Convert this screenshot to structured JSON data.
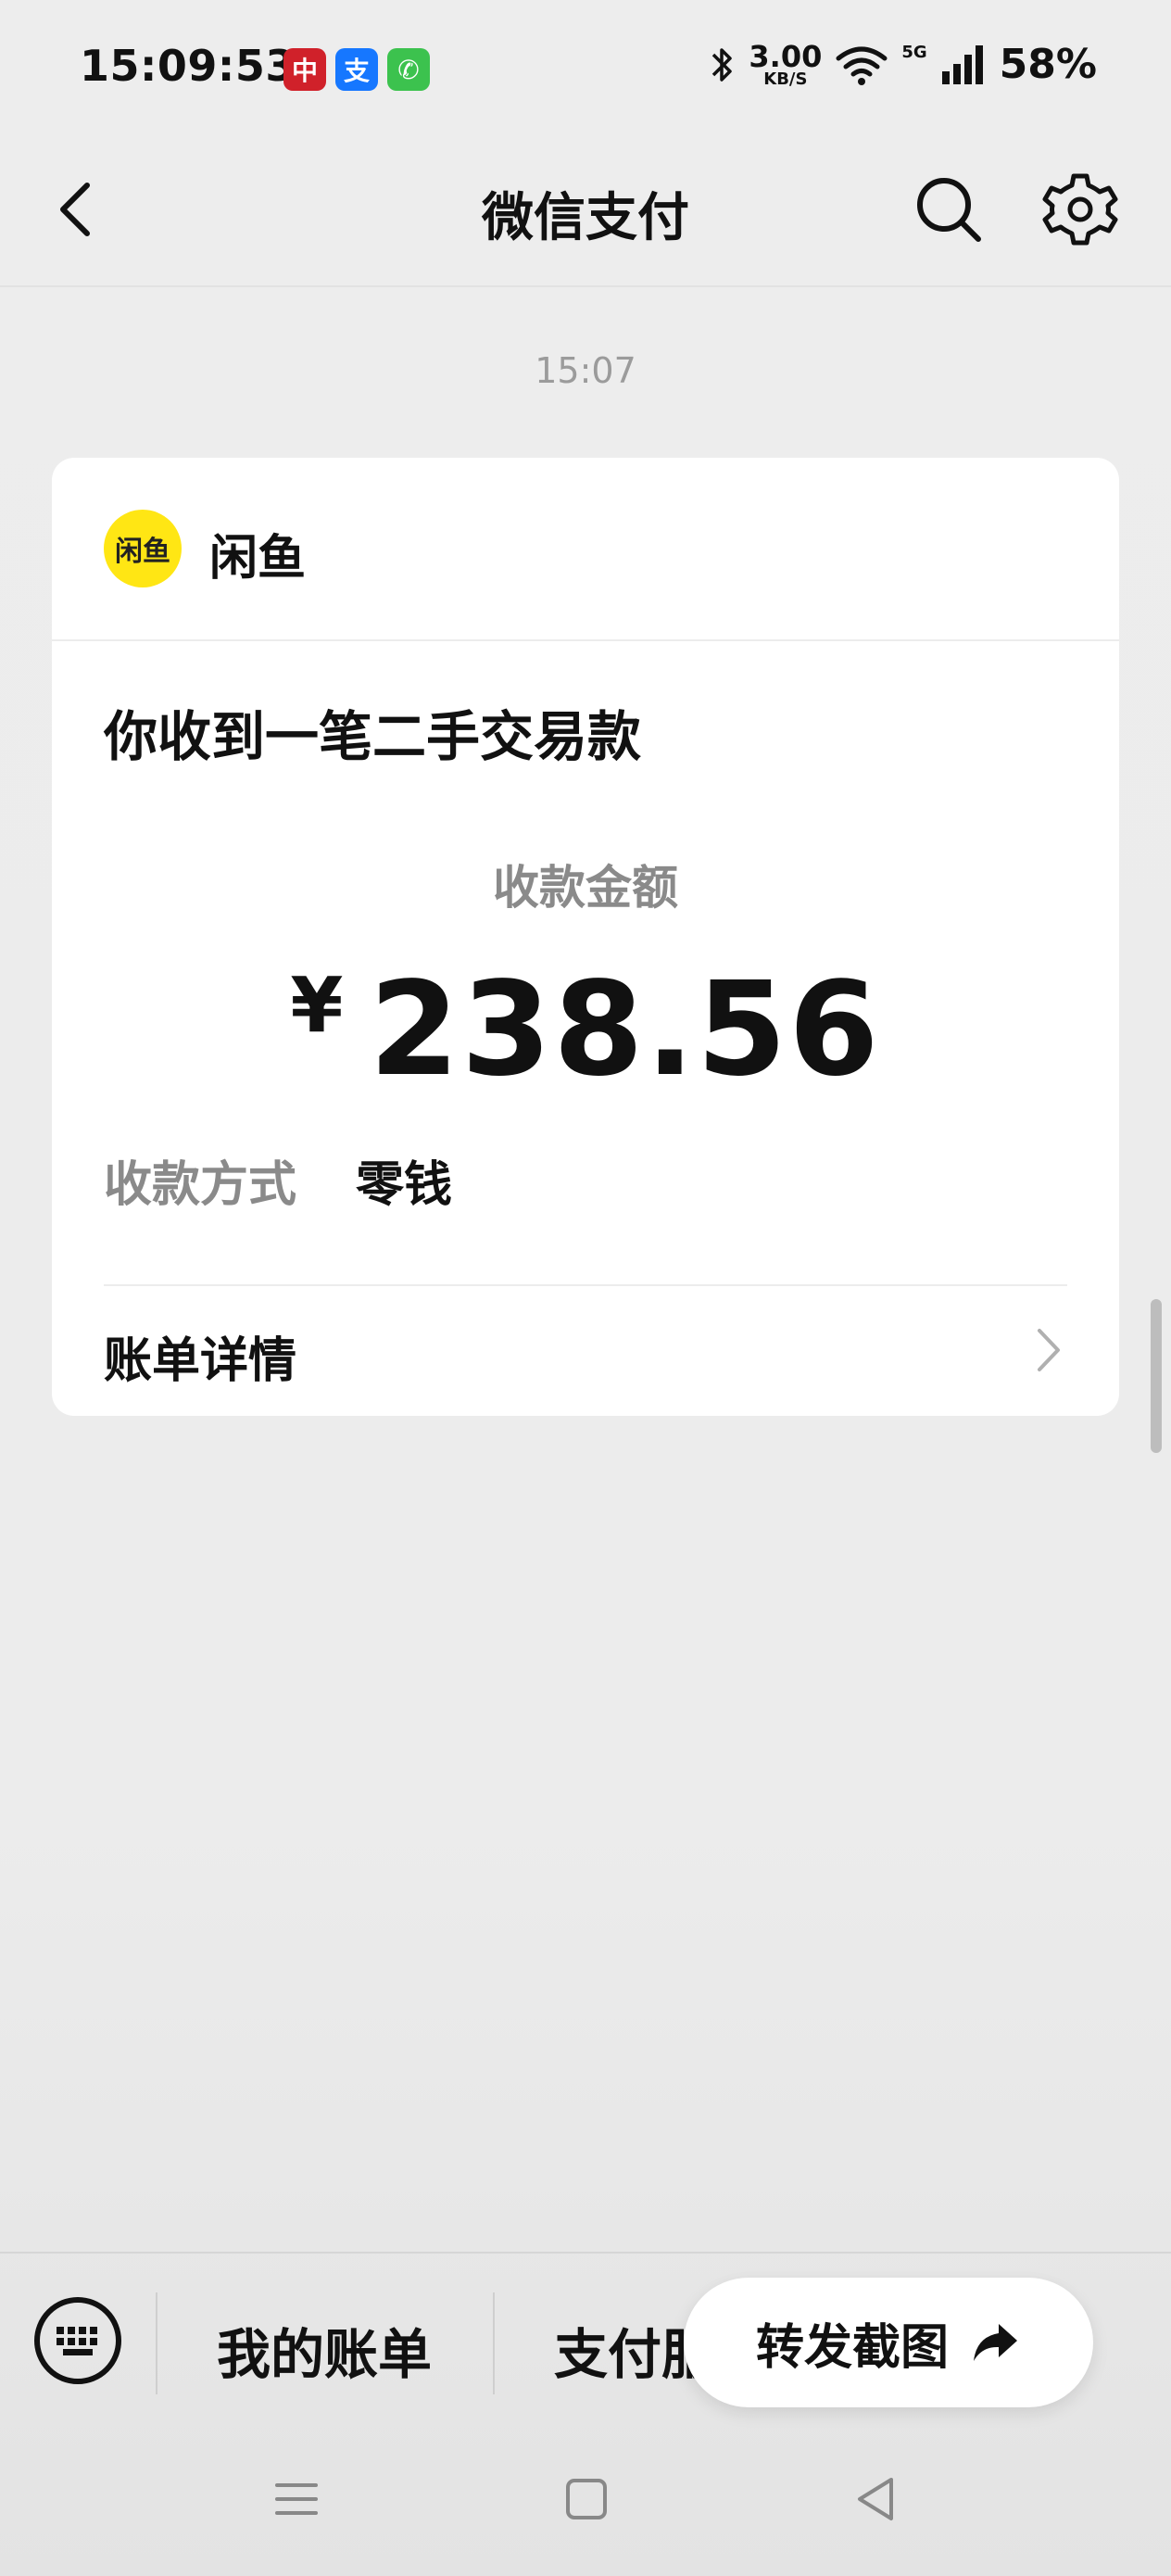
{
  "status_bar": {
    "time": "15:09:53",
    "apps": [
      {
        "name": "citic-bank-icon",
        "glyph": "中",
        "color": "#d0212a"
      },
      {
        "name": "alipay-icon",
        "glyph": "支",
        "color": "#1677ff"
      },
      {
        "name": "phone-icon",
        "glyph": "✆",
        "color": "#3cc24e"
      }
    ],
    "net_speed_value": "3.00",
    "net_speed_unit": "KB/S",
    "network_type": "5G",
    "battery": "58%"
  },
  "nav": {
    "title": "微信支付"
  },
  "message": {
    "time": "15:07"
  },
  "card": {
    "merchant_logo_text": "闲鱼",
    "merchant_name": "闲鱼",
    "title": "你收到一笔二手交易款",
    "amount_label": "收款金额",
    "currency": "¥",
    "amount": "238.56",
    "method_label": "收款方式",
    "method_value": "零钱",
    "detail_label": "账单详情"
  },
  "bottom_menu": {
    "items": [
      "我的账单",
      "支付服务"
    ],
    "forward_label": "转发截图"
  },
  "colors": {
    "background": "#ededed",
    "card": "#ffffff",
    "logo_yellow": "#ffe614",
    "muted_text": "#8a8a8a"
  }
}
